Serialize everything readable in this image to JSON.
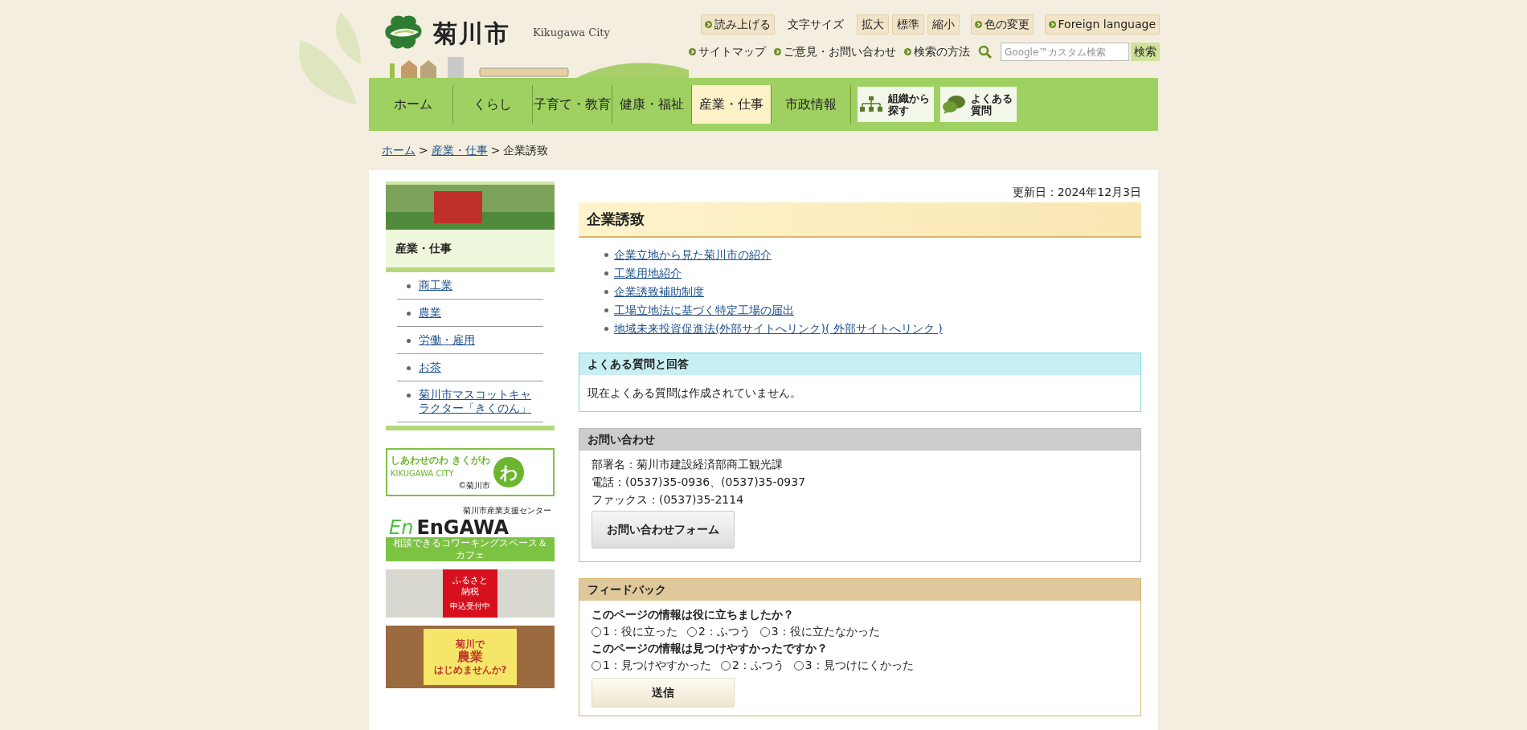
{
  "header": {
    "site_name": "菊川市",
    "site_name_en": "Kikugawa City",
    "utility": [
      {
        "kind": "button",
        "label": "読み上げる"
      },
      {
        "kind": "label",
        "label": "文字サイズ"
      },
      {
        "kind": "size",
        "label": "拡大"
      },
      {
        "kind": "size",
        "label": "標準"
      },
      {
        "kind": "size",
        "label": "縮小"
      },
      {
        "kind": "button",
        "label": "色の変更"
      },
      {
        "kind": "button",
        "label": "Foreign language"
      }
    ],
    "links": [
      "サイトマップ",
      "ご意見・お問い合わせ",
      "検索の方法"
    ],
    "search": {
      "placeholder": "Google™カスタム検索",
      "button": "検索"
    }
  },
  "nav": [
    {
      "kind": "tab",
      "label": "ホーム",
      "selected": false
    },
    {
      "kind": "tab",
      "label": "くらし",
      "selected": false
    },
    {
      "kind": "tab",
      "label": "子育て・教育",
      "selected": false
    },
    {
      "kind": "tab",
      "label": "健康・福祉",
      "selected": false
    },
    {
      "kind": "tab",
      "label": "産業・仕事",
      "selected": true
    },
    {
      "kind": "tab",
      "label": "市政情報",
      "selected": false
    },
    {
      "kind": "org",
      "label": "組織から探す",
      "selected": false
    },
    {
      "kind": "faq",
      "label": "よくある質問",
      "selected": false
    }
  ],
  "breadcrumb_separator": ">",
  "breadcrumb": [
    {
      "label": "ホーム",
      "link": true
    },
    {
      "label": "産業・仕事",
      "link": true
    },
    {
      "label": "企業誘致",
      "link": false
    }
  ],
  "sidebar": {
    "heading": "産業・仕事",
    "items": [
      "商工業",
      "農業",
      "労働・雇用",
      "お茶",
      "菊川市マスコットキャラクター「きくのん」"
    ],
    "banners": [
      {
        "kind": "shiawase",
        "texts": [
          "しあわせのわ きくがわ",
          "KIKUGAWA CITY",
          "©菊川市",
          "わ"
        ]
      },
      {
        "kind": "engawa",
        "texts": [
          "菊川市産業支援センター",
          "En",
          "EnGAWA",
          "相談できるコワーキングスペース＆カフェ"
        ]
      },
      {
        "kind": "furusato",
        "texts": [
          "ふるさと納税",
          "申込受付中"
        ]
      },
      {
        "kind": "nogyo",
        "texts": [
          "菊川で",
          "農業",
          "はじめませんか?"
        ]
      }
    ]
  },
  "main": {
    "updated": "更新日：2024年12月3日",
    "title": "企業誘致",
    "links": [
      "企業立地から見た菊川市の紹介",
      "工業用地紹介",
      "企業誘致補助制度",
      "工場立地法に基づく特定工場の届出",
      "地域未来投資促進法(外部サイトへリンク)( 外部サイトへリンク )"
    ],
    "faq": {
      "title": "よくある質問と回答",
      "text": "現在よくある質問は作成されていません。"
    },
    "contact": {
      "title": "お問い合わせ",
      "lines": [
        "部署名：菊川市建設経済部商工観光課",
        "電話：(0537)35-0936、(0537)35-0937",
        "ファックス：(0537)35-2114"
      ],
      "button": "お問い合わせフォーム"
    },
    "feedback": {
      "title": "フィードバック",
      "questions": [
        {
          "question": "このページの情報は役に立ちましたか？",
          "options": [
            {
              "label": "1：役に立った",
              "selected": false
            },
            {
              "label": "2：ふつう",
              "selected": false
            },
            {
              "label": "3：役に立たなかった",
              "selected": false
            }
          ]
        },
        {
          "question": "このページの情報は見つけやすかったですか？",
          "options": [
            {
              "label": "1：見つけやすかった",
              "selected": false
            },
            {
              "label": "2：ふつう",
              "selected": false
            },
            {
              "label": "3：見つけにくかった",
              "selected": false
            }
          ]
        }
      ],
      "button": "送信"
    }
  }
}
